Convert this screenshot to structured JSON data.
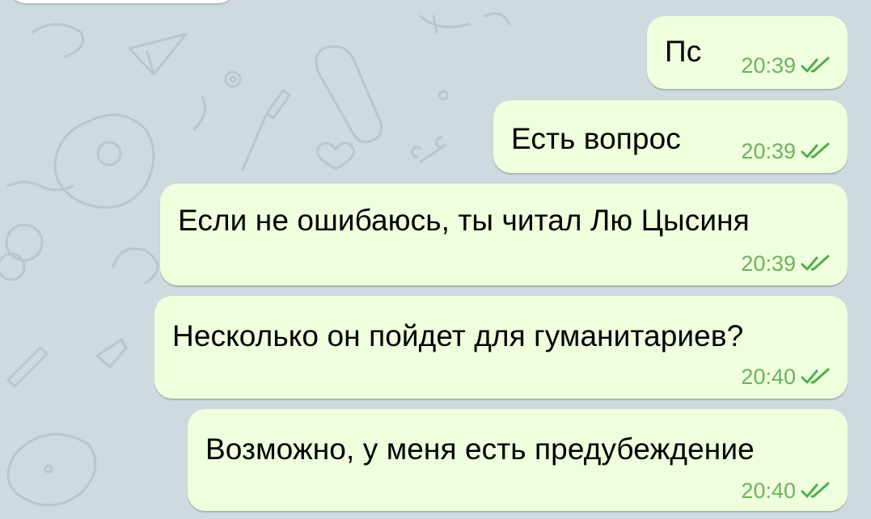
{
  "colors": {
    "background": "#cfd9e0",
    "outgoing_bubble": "#effedd",
    "meta_text": "#6cb25f",
    "read_check": "#4fae4e"
  },
  "messages": [
    {
      "text": "Пс",
      "time": "20:39",
      "status": "read-double-check-icon"
    },
    {
      "text": "Есть вопрос",
      "time": "20:39",
      "status": "read-double-check-icon"
    },
    {
      "text": "Если не ошибаюсь, ты читал Лю Цысиня",
      "time": "20:39",
      "status": "read-double-check-icon"
    },
    {
      "text": "Несколько он пойдет для гуманитариев?",
      "time": "20:40",
      "status": "read-double-check-icon"
    },
    {
      "text": "Возможно, у меня есть предубеждение",
      "time": "20:40",
      "status": "read-double-check-icon"
    }
  ]
}
